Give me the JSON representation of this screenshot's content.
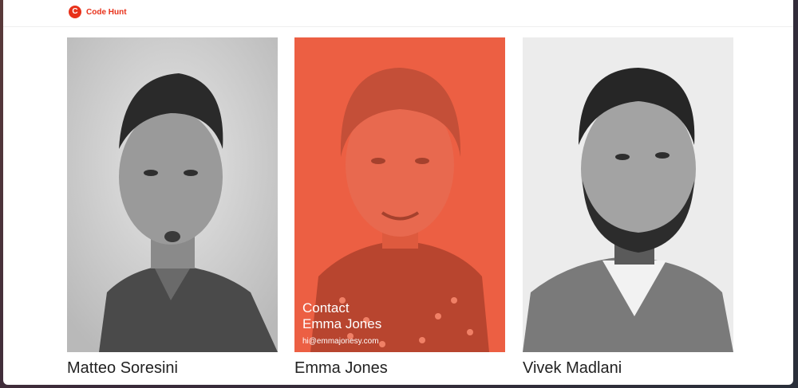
{
  "brand": {
    "name": "Code Hunt",
    "logo_letter": "C",
    "accent": "#e8311a"
  },
  "people": [
    {
      "name": "Matteo Soresini"
    },
    {
      "name": "Emma Jones",
      "contact_line1": "Contact",
      "contact_line2": "Emma Jones",
      "email": "hi@emmajonesy.com",
      "highlight": "#ec5f43"
    },
    {
      "name": "Vivek Madlani"
    }
  ]
}
